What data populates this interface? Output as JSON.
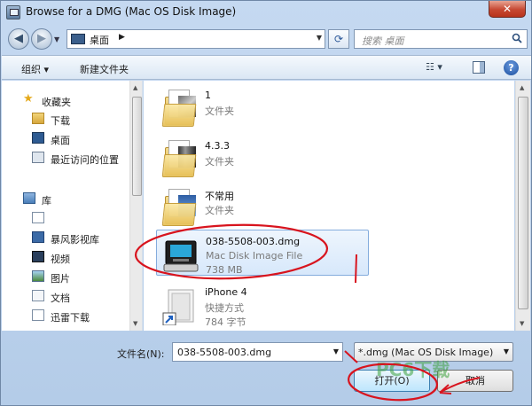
{
  "window": {
    "title": "Browse for a DMG (Mac OS Disk Image)",
    "close_glyph": "✕"
  },
  "address_bar": {
    "location": "桌面",
    "separator": "▶"
  },
  "search": {
    "placeholder": "搜索 桌面"
  },
  "toolbar": {
    "organize": "组织 ▾",
    "new_folder": "新建文件夹",
    "view_icon": "view-options-icon",
    "preview_icon": "preview-pane-icon",
    "help": "?"
  },
  "sidebar": {
    "items": [
      {
        "label": "收藏夹",
        "icon": "star-icon",
        "type": "header"
      },
      {
        "label": "下载",
        "icon": "download-folder-icon"
      },
      {
        "label": "桌面",
        "icon": "desktop-icon"
      },
      {
        "label": "最近访问的位置",
        "icon": "recent-places-icon"
      },
      {
        "label": "库",
        "icon": "library-icon",
        "type": "header"
      },
      {
        "label": "",
        "icon": "document-icon"
      },
      {
        "label": "暴风影视库",
        "icon": "video-library-icon"
      },
      {
        "label": "视频",
        "icon": "video-icon"
      },
      {
        "label": "图片",
        "icon": "picture-icon"
      },
      {
        "label": "文档",
        "icon": "documents-icon"
      },
      {
        "label": "迅雷下载",
        "icon": "thunder-download-icon"
      }
    ]
  },
  "files": [
    {
      "name": "1",
      "type": "文件夹",
      "size": "",
      "icon": "folder-icon"
    },
    {
      "name": "4.3.3",
      "type": "文件夹",
      "size": "",
      "icon": "folder-icon"
    },
    {
      "name": "不常用",
      "type": "文件夹",
      "size": "",
      "icon": "folder-icon"
    },
    {
      "name": "038-5508-003.dmg",
      "type": "Mac Disk Image File",
      "size": "738 MB",
      "icon": "disk-image-icon",
      "selected": true
    },
    {
      "name": "iPhone 4",
      "type": "快捷方式",
      "size": "784 字节",
      "icon": "shortcut-icon"
    }
  ],
  "footer": {
    "filename_label": "文件名(N):",
    "filename_value": "038-5508-003.dmg",
    "filter_value": "*.dmg (Mac OS Disk Image)",
    "open_label": "打开(O)",
    "cancel_label": "取消"
  },
  "watermark": "PC6下载",
  "colors": {
    "annotation": "#d8141e",
    "selection": "#cfe3fb",
    "accent": "#3c7fb1"
  }
}
